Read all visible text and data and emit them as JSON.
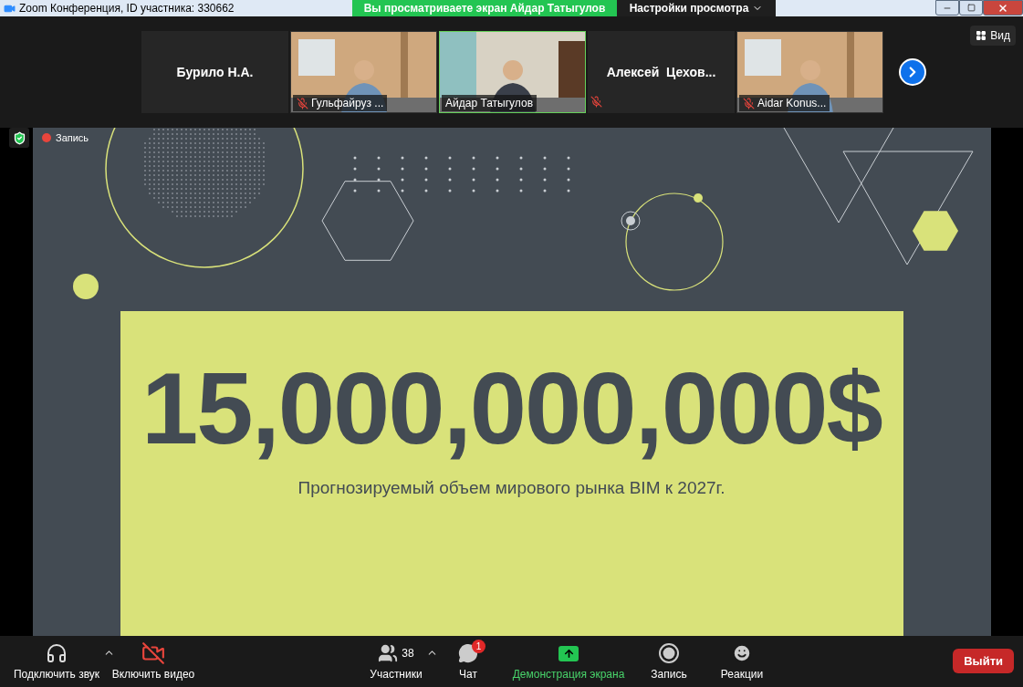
{
  "window": {
    "title": "Zoom Конференция, ID участника: 330662"
  },
  "share_banner": {
    "text": "Вы просматриваете экран Айдар Татыгулов",
    "view_settings": "Настройки просмотра"
  },
  "participants": [
    {
      "kind": "name",
      "name": "Бурило Н.А.",
      "muted": false,
      "selected": false
    },
    {
      "kind": "video",
      "name": "Гульфайруз ...",
      "muted": true,
      "selected": false
    },
    {
      "kind": "video",
      "name": "Айдар Татыгулов",
      "muted": false,
      "selected": true
    },
    {
      "kind": "name",
      "name": "Алексей  Цехов...",
      "muted": true,
      "selected": false
    },
    {
      "kind": "video",
      "name": "Aidar Konus...",
      "muted": true,
      "selected": false
    }
  ],
  "view_button": "Вид",
  "recording": {
    "label": "Запись"
  },
  "slide": {
    "amount": "15,000,000,000$",
    "caption": "Прогнозируемый объем мирового рынка BIM к 2027г."
  },
  "toolbar": {
    "left": [
      {
        "kind": "audio",
        "label": "Подключить звук"
      },
      {
        "kind": "video",
        "label": "Включить видео"
      }
    ],
    "center": [
      {
        "kind": "participants",
        "label": "Участники",
        "count": "38"
      },
      {
        "kind": "chat",
        "label": "Чат",
        "badge": "1"
      },
      {
        "kind": "share",
        "label": "Демонстрация экрана"
      },
      {
        "kind": "record",
        "label": "Запись"
      },
      {
        "kind": "reactions",
        "label": "Реакции"
      }
    ],
    "leave": "Выйти"
  }
}
